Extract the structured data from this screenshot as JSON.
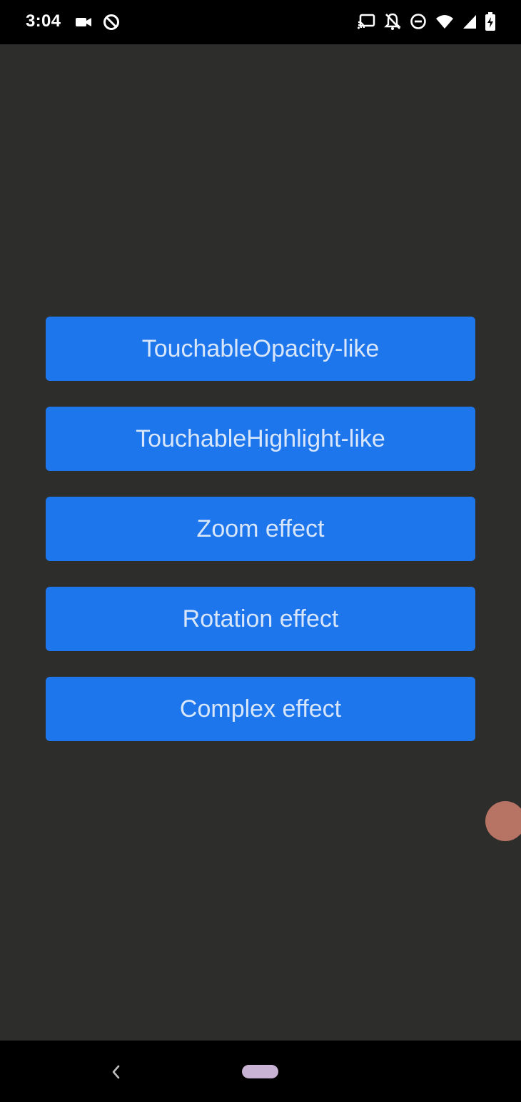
{
  "status_bar": {
    "time": "3:04",
    "left_icons": [
      "video-camera-icon",
      "data-saver-icon"
    ],
    "right_icons": [
      "cast-icon",
      "notifications-off-icon",
      "do-not-disturb-icon",
      "wifi-icon",
      "signal-icon",
      "battery-charging-icon"
    ]
  },
  "buttons": [
    {
      "label": "TouchableOpacity-like"
    },
    {
      "label": "TouchableHighlight-like"
    },
    {
      "label": "Zoom effect"
    },
    {
      "label": "Rotation effect"
    },
    {
      "label": "Complex effect"
    }
  ],
  "colors": {
    "background": "#2d2e2c",
    "button": "#1e76ec",
    "button_text": "#d8e6fb",
    "system_bars": "#000000",
    "touch_indicator": "#d68270"
  },
  "nav_bar": {
    "icons": [
      "back-icon",
      "home-pill-icon"
    ]
  }
}
